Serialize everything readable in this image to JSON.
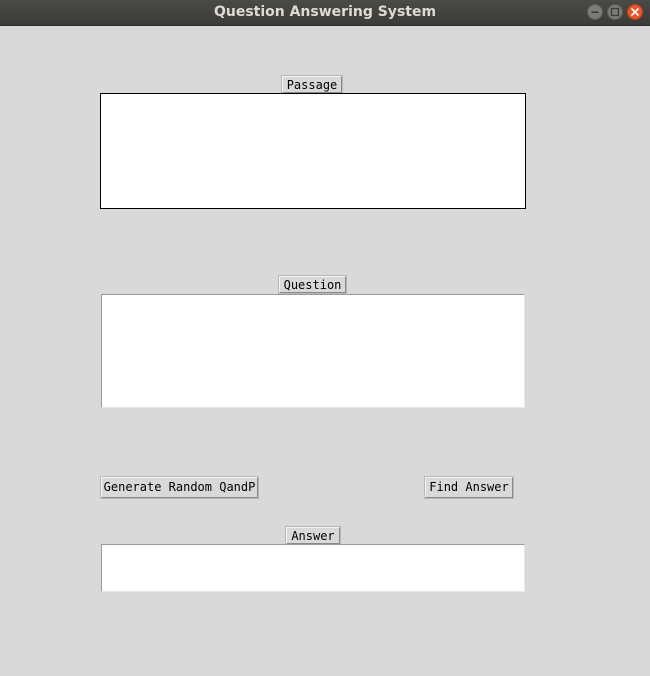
{
  "window": {
    "title": "Question Answering System",
    "controls": {
      "minimize_icon": "minimize-icon",
      "maximize_icon": "maximize-icon",
      "close_icon": "close-icon"
    }
  },
  "passage": {
    "label": "Passage",
    "value": ""
  },
  "question": {
    "label": "Question",
    "value": ""
  },
  "actions": {
    "generate_label": "Generate Random QandP",
    "find_label": "Find Answer"
  },
  "answer": {
    "label": "Answer",
    "value": ""
  },
  "colors": {
    "background": "#d9d9d9",
    "titlebar": "#3b3b38",
    "close_button": "#e8572a"
  }
}
